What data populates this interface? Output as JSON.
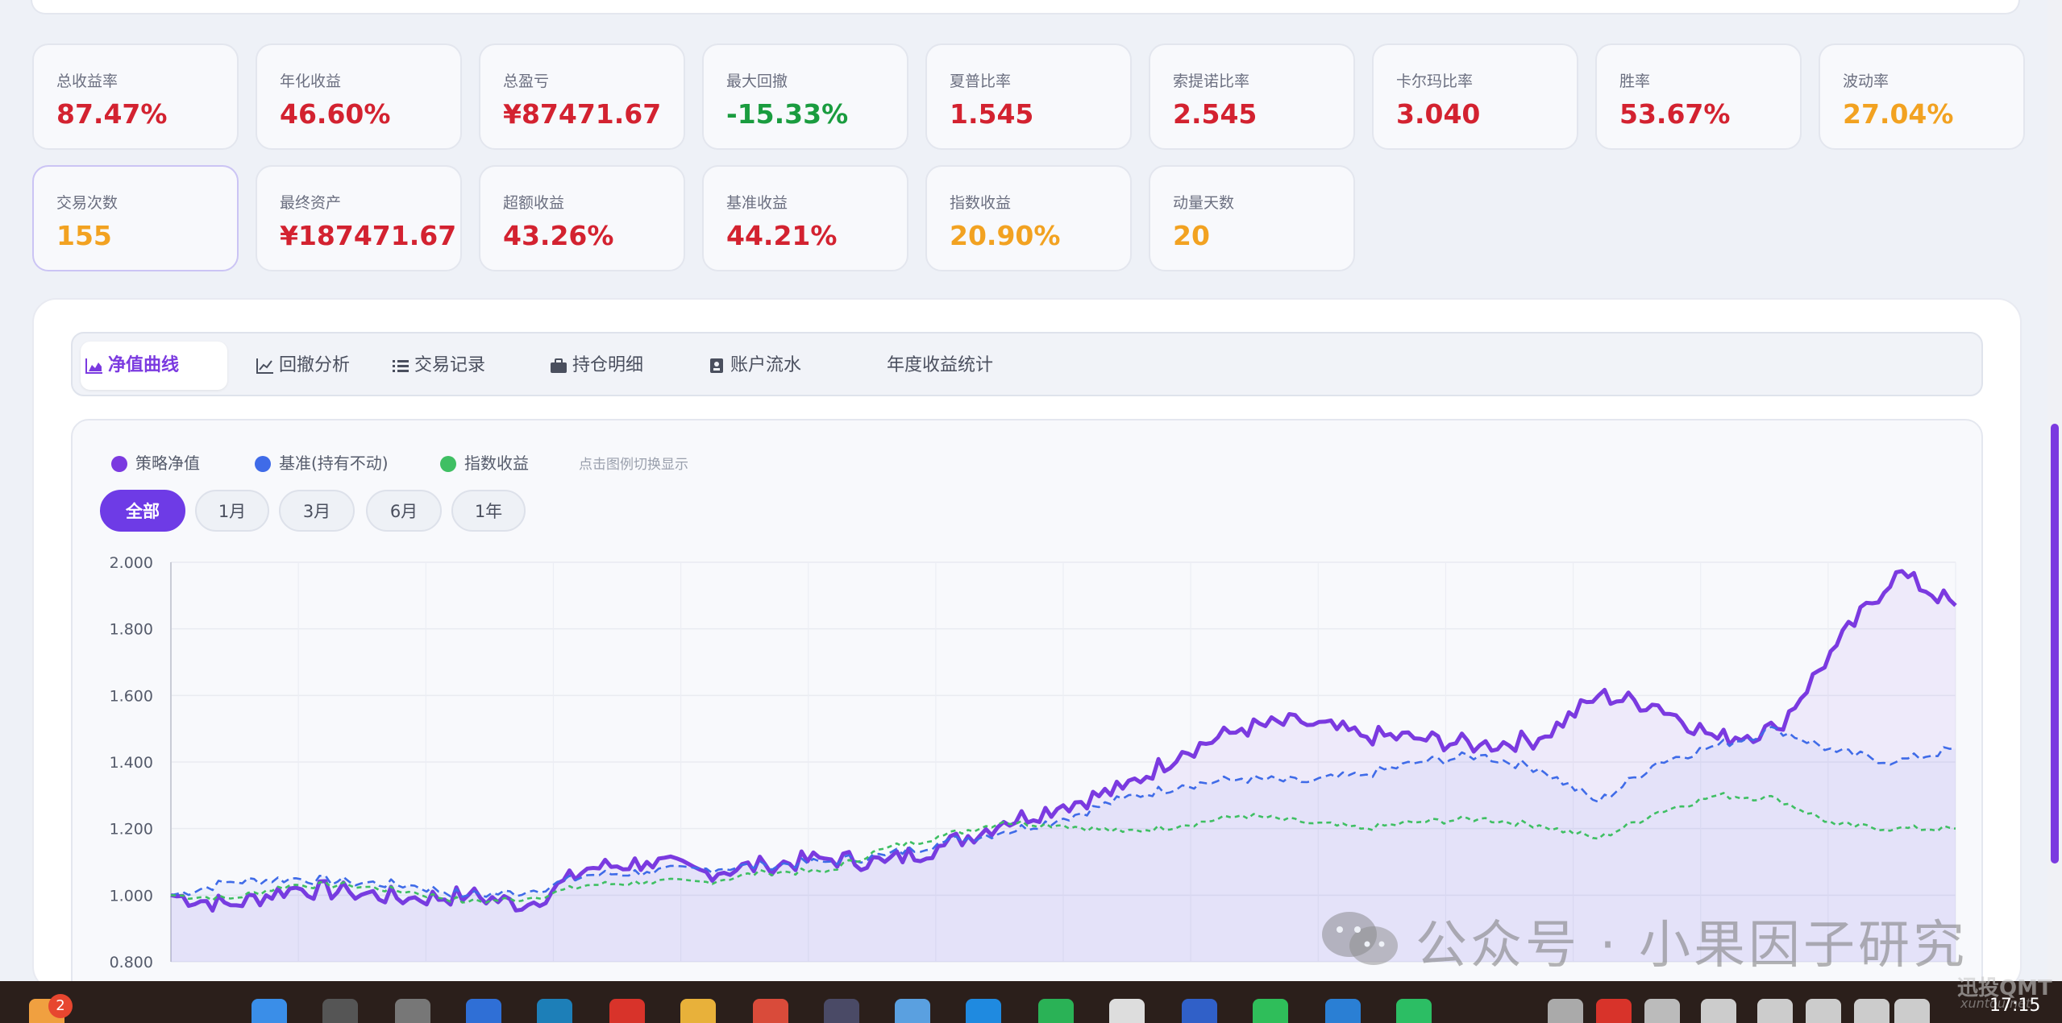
{
  "metrics": [
    {
      "label": "总收益率",
      "value": "87.47%",
      "tone": "red"
    },
    {
      "label": "年化收益",
      "value": "46.60%",
      "tone": "red"
    },
    {
      "label": "总盈亏",
      "value": "¥87471.67",
      "tone": "red"
    },
    {
      "label": "最大回撤",
      "value": "-15.33%",
      "tone": "green"
    },
    {
      "label": "夏普比率",
      "value": "1.545",
      "tone": "red"
    },
    {
      "label": "索提诺比率",
      "value": "2.545",
      "tone": "red"
    },
    {
      "label": "卡尔玛比率",
      "value": "3.040",
      "tone": "red"
    },
    {
      "label": "胜率",
      "value": "53.67%",
      "tone": "red"
    },
    {
      "label": "波动率",
      "value": "27.04%",
      "tone": "orange"
    },
    {
      "label": "交易次数",
      "value": "155",
      "tone": "orange"
    },
    {
      "label": "最终资产",
      "value": "¥187471.67",
      "tone": "red"
    },
    {
      "label": "超额收益",
      "value": "43.26%",
      "tone": "red"
    },
    {
      "label": "基准收益",
      "value": "44.21%",
      "tone": "red"
    },
    {
      "label": "指数收益",
      "value": "20.90%",
      "tone": "orange"
    },
    {
      "label": "动量天数",
      "value": "20",
      "tone": "orange"
    }
  ],
  "tabs": [
    {
      "label": "净值曲线",
      "icon": "area-chart-icon",
      "active": true
    },
    {
      "label": "回撤分析",
      "icon": "line-chart-icon"
    },
    {
      "label": "交易记录",
      "icon": "list-icon"
    },
    {
      "label": "持仓明细",
      "icon": "briefcase-icon"
    },
    {
      "label": "账户流水",
      "icon": "ledger-icon"
    },
    {
      "label": "年度收益统计",
      "icon": ""
    }
  ],
  "legend": {
    "items": [
      {
        "label": "策略净值",
        "color": "#7b3ae0"
      },
      {
        "label": "基准(持有不动)",
        "color": "#3f6be8"
      },
      {
        "label": "指数收益",
        "color": "#3fbf63"
      }
    ],
    "hint": "点击图例切换显示"
  },
  "ranges": [
    "全部",
    "1月",
    "3月",
    "6月",
    "1年"
  ],
  "colors": {
    "accent": "#7b3ae0",
    "benchmark": "#3f6be8",
    "index": "#3fbf63",
    "up": "#d32230",
    "down": "#1a9c3f",
    "warn": "#f2a221"
  },
  "watermark": "公众号 · 小果因子研究",
  "taskbar": {
    "badge": "2",
    "clock": "17:15",
    "logo": "迅投QMT",
    "logo_sub": "xuntou.net"
  },
  "chart_data": {
    "type": "line",
    "ylim": [
      0.8,
      2.0
    ],
    "yticks": [
      "0.800",
      "1.000",
      "1.200",
      "1.400",
      "1.600",
      "1.800",
      "2.000"
    ],
    "x_index": [
      0,
      10,
      20,
      30,
      40,
      50,
      60,
      70,
      80,
      90,
      100,
      110,
      120,
      130,
      140,
      150,
      160,
      170,
      180,
      190,
      200,
      210,
      220,
      230,
      240,
      250,
      260,
      270,
      280,
      290,
      300
    ],
    "series": [
      {
        "name": "策略净值",
        "values": [
          1.0,
          0.97,
          1.02,
          1.01,
          0.99,
          1.0,
          0.97,
          1.08,
          1.1,
          1.07,
          1.09,
          1.11,
          1.1,
          1.15,
          1.22,
          1.27,
          1.32,
          1.43,
          1.5,
          1.52,
          1.48,
          1.47,
          1.45,
          1.47,
          1.6,
          1.57,
          1.47,
          1.5,
          1.75,
          1.97,
          1.87
        ]
      },
      {
        "name": "基准(持有不动)",
        "values": [
          1.0,
          1.04,
          1.05,
          1.04,
          1.03,
          1.0,
          1.01,
          1.06,
          1.07,
          1.08,
          1.09,
          1.1,
          1.12,
          1.16,
          1.19,
          1.23,
          1.29,
          1.33,
          1.35,
          1.34,
          1.36,
          1.4,
          1.42,
          1.38,
          1.28,
          1.4,
          1.45,
          1.5,
          1.43,
          1.4,
          1.44
        ]
      },
      {
        "name": "指数收益",
        "values": [
          1.0,
          0.99,
          1.03,
          1.03,
          1.01,
          0.98,
          0.99,
          1.03,
          1.04,
          1.04,
          1.07,
          1.07,
          1.14,
          1.18,
          1.22,
          1.21,
          1.19,
          1.21,
          1.24,
          1.22,
          1.2,
          1.22,
          1.23,
          1.21,
          1.17,
          1.25,
          1.3,
          1.29,
          1.21,
          1.2,
          1.2
        ]
      }
    ]
  }
}
